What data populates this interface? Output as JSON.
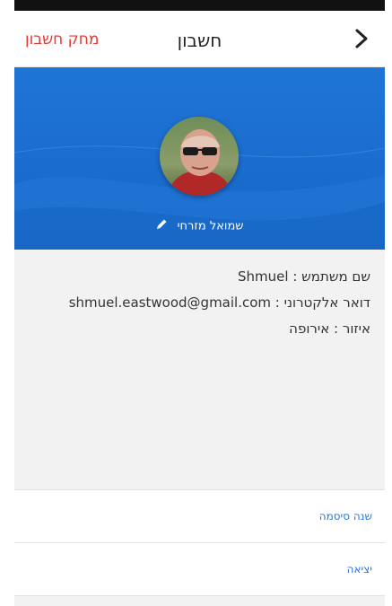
{
  "header": {
    "title": "חשבון",
    "delete_label": "מחק חשבון",
    "back_icon": "chevron-right-icon"
  },
  "profile": {
    "display_name": "שמואל מזרחי",
    "edit_icon": "pencil-icon"
  },
  "info": {
    "username_label": "שם משתמש : ",
    "username_value": "Shmuel",
    "email_label": "דואר אלקטרוני : ",
    "email_value": "shmuel.eastwood@gmail.com",
    "region_label": "איזור : ",
    "region_value": "אירופה"
  },
  "actions": {
    "change_password": "שנה סיסמה",
    "logout": "יציאה"
  },
  "colors": {
    "accent_blue": "#1f75d6",
    "danger_red": "#e53935",
    "link_blue": "#2a78d6"
  }
}
